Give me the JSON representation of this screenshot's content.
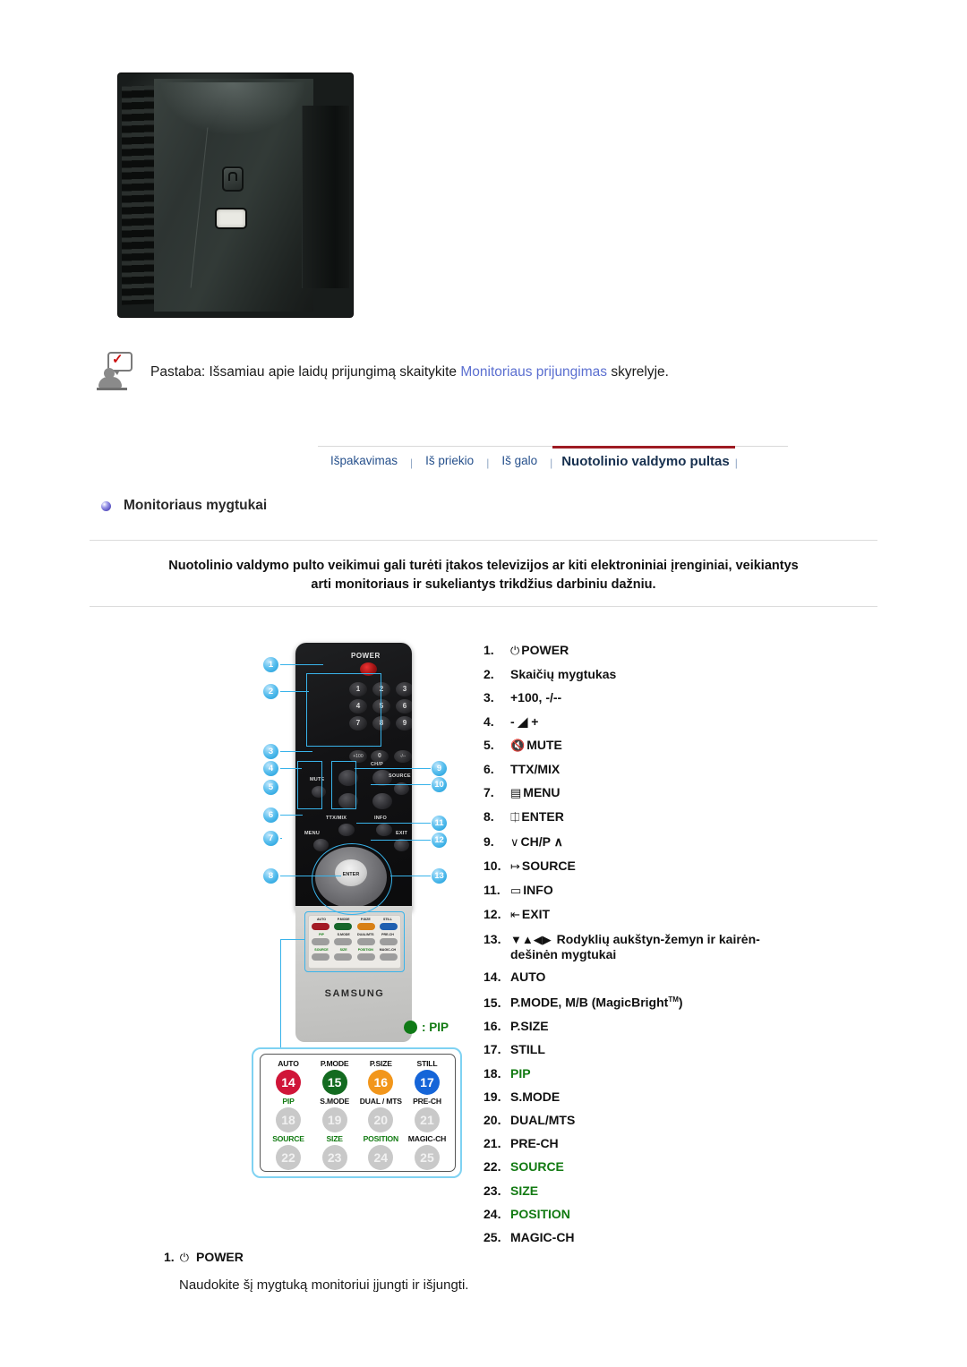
{
  "note": {
    "icon": "note-person-check-icon",
    "text_before": "Pastaba: Išsamiau apie laidų prijungimą skaitykite ",
    "link_text": "Monitoriaus prijungimas",
    "text_after": " skyrelyje."
  },
  "tabs": [
    {
      "label": "Išpakavimas",
      "active": false
    },
    {
      "label": "Iš priekio",
      "active": false
    },
    {
      "label": "Iš galo",
      "active": false
    },
    {
      "label": "Nuotolinio valdymo pultas",
      "active": true
    }
  ],
  "tab_separator": "|",
  "section": {
    "title": "Monitoriaus mygtukai",
    "bullet_color": "#5f57c4"
  },
  "warning": {
    "line1": "Nuotolinio valdymo pulto veikimui gali turėti įtakos televizijos ar kiti elektroniniai įrenginiai, veikiantys",
    "line2": "arti monitoriaus ir sukeliantys trikdžius darbiniu dažniu."
  },
  "remote": {
    "power_label": "POWER",
    "numpad": [
      "1",
      "2",
      "3",
      "4",
      "5",
      "6",
      "7",
      "8",
      "9"
    ],
    "key_plus100": "+100",
    "key_zero": "0",
    "key_minus": "-/--",
    "label_mute": "MUTE",
    "label_chp": "CH/P",
    "label_source": "SOURCE",
    "label_ttxmix": "TTX/MIX",
    "label_info": "INFO",
    "label_menu": "MENU",
    "label_exit": "EXIT",
    "label_enter": "ENTER",
    "brand": "SAMSUNG",
    "mini_pad": {
      "row1": [
        "AUTO",
        "P.MODE",
        "P.SIZE",
        "STILL"
      ],
      "row2": [
        "PIP",
        "S.MODE",
        "DUAL/MTS",
        "PRE-CH"
      ],
      "row3": [
        "SOURCE",
        "SIZE",
        "POSITION",
        "MAGIC-CH"
      ]
    },
    "callouts": [
      "1",
      "2",
      "3",
      "4",
      "5",
      "6",
      "7",
      "8",
      "9",
      "10",
      "11",
      "12",
      "13"
    ]
  },
  "pip_legend": {
    "symbol": "green-dot-icon",
    "text": ": PIP",
    "color": "#117a11"
  },
  "magnified_panel": {
    "rows": [
      {
        "cells": [
          {
            "caption": "AUTO",
            "caption_green": false,
            "number": "14",
            "color": "red"
          },
          {
            "caption": "P.MODE",
            "caption_green": false,
            "number": "15",
            "color": "green"
          },
          {
            "caption": "P.SIZE",
            "caption_green": false,
            "number": "16",
            "color": "orange"
          },
          {
            "caption": "STILL",
            "caption_green": false,
            "number": "17",
            "color": "blue"
          }
        ]
      },
      {
        "cells": [
          {
            "caption": "PIP",
            "caption_green": true,
            "number": "18",
            "color": "gray"
          },
          {
            "caption": "S.MODE",
            "caption_green": false,
            "number": "19",
            "color": "gray"
          },
          {
            "caption": "DUAL / MTS",
            "caption_green": false,
            "number": "20",
            "color": "gray"
          },
          {
            "caption": "PRE-CH",
            "caption_green": false,
            "number": "21",
            "color": "gray"
          }
        ]
      },
      {
        "cells": [
          {
            "caption": "SOURCE",
            "caption_green": true,
            "number": "22",
            "color": "gray"
          },
          {
            "caption": "SIZE",
            "caption_green": true,
            "number": "23",
            "color": "gray"
          },
          {
            "caption": "POSITION",
            "caption_green": true,
            "number": "24",
            "color": "gray"
          },
          {
            "caption": "MAGIC-CH",
            "caption_green": false,
            "number": "25",
            "color": "gray"
          }
        ]
      }
    ]
  },
  "button_list": [
    {
      "num": "1.",
      "icon": "power-icon",
      "glyph": "⏻",
      "text": "POWER",
      "green": false
    },
    {
      "num": "2.",
      "icon": "",
      "glyph": "",
      "text": "Skaičių mygtukas",
      "green": false
    },
    {
      "num": "3.",
      "icon": "",
      "glyph": "",
      "text": "+100, -/--",
      "green": false
    },
    {
      "num": "4.",
      "icon": "volume-icon",
      "glyph": "-  ◢ +",
      "text": "",
      "green": false
    },
    {
      "num": "5.",
      "icon": "mute-icon",
      "glyph": "ὐ7",
      "text": "MUTE",
      "green": false
    },
    {
      "num": "6.",
      "icon": "",
      "glyph": "",
      "text": "TTX/MIX",
      "green": false
    },
    {
      "num": "7.",
      "icon": "menu-icon",
      "glyph": "▤",
      "text": "MENU",
      "green": false
    },
    {
      "num": "8.",
      "icon": "enter-icon",
      "glyph": "↵",
      "text": "ENTER",
      "green": false
    },
    {
      "num": "9.",
      "icon": "chp-icon",
      "glyph": "∨",
      "text": "CH/P ∧",
      "green": false
    },
    {
      "num": "10.",
      "icon": "source-icon",
      "glyph": "↦",
      "text": "SOURCE",
      "green": false
    },
    {
      "num": "11.",
      "icon": "info-icon",
      "glyph": "▭",
      "text": "INFO",
      "green": false
    },
    {
      "num": "12.",
      "icon": "exit-icon",
      "glyph": "⇥",
      "text": "EXIT",
      "green": false
    },
    {
      "num": "13.",
      "icon": "arrows-icon",
      "glyph": "▼▲◀▶",
      "text": "Rodyklių aukštyn-žemyn ir kairėn-dešinėn mygtukai",
      "green": false
    },
    {
      "num": "14.",
      "icon": "",
      "glyph": "",
      "text": "AUTO",
      "green": false
    },
    {
      "num": "15.",
      "icon": "",
      "glyph": "",
      "text": "P.MODE, M/B (MagicBright",
      "sup": "TM",
      "text_tail": ")",
      "green": false
    },
    {
      "num": "16.",
      "icon": "",
      "glyph": "",
      "text": "P.SIZE",
      "green": false
    },
    {
      "num": "17.",
      "icon": "",
      "glyph": "",
      "text": "STILL",
      "green": false
    },
    {
      "num": "18.",
      "icon": "",
      "glyph": "",
      "text": "PIP",
      "green": true
    },
    {
      "num": "19.",
      "icon": "",
      "glyph": "",
      "text": "S.MODE",
      "green": false
    },
    {
      "num": "20.",
      "icon": "",
      "glyph": "",
      "text": "DUAL/MTS",
      "green": false
    },
    {
      "num": "21.",
      "icon": "",
      "glyph": "",
      "text": "PRE-CH",
      "green": false
    },
    {
      "num": "22.",
      "icon": "",
      "glyph": "",
      "text": "SOURCE",
      "green": true
    },
    {
      "num": "23.",
      "icon": "",
      "glyph": "",
      "text": "SIZE",
      "green": true
    },
    {
      "num": "24.",
      "icon": "",
      "glyph": "",
      "text": "POSITION",
      "green": true
    },
    {
      "num": "25.",
      "icon": "",
      "glyph": "",
      "text": "MAGIC-CH",
      "green": false
    }
  ],
  "detail": {
    "num": "1.",
    "icon_glyph": "⏻",
    "title": "POWER",
    "description": "Naudokite šį mygtuką monitoriui įjungti ir išjungti."
  }
}
